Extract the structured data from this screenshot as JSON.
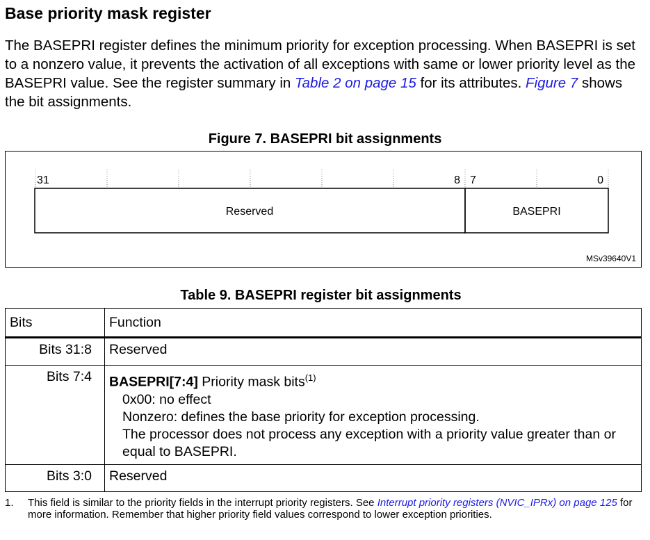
{
  "section_title": "Base priority mask register",
  "intro": {
    "text_before_link1": "The BASEPRI register defines the minimum priority for exception processing. When BASEPRI is set to a nonzero value, it prevents the activation of all exceptions with same or lower priority level as the BASEPRI value. See the register summary in ",
    "link1": "Table 2 on page 15",
    "text_between": " for its attributes. ",
    "link2": "Figure 7",
    "text_after": " shows the bit assignments."
  },
  "figure": {
    "caption": "Figure 7. BASEPRI bit assignments",
    "bit_labels": {
      "b31": "31",
      "b8": "8",
      "b7": "7",
      "b0": "0"
    },
    "fields": {
      "reserved": "Reserved",
      "basepri": "BASEPRI"
    },
    "id": "MSv39640V1"
  },
  "table": {
    "caption": "Table 9. BASEPRI register bit assignments",
    "headers": {
      "bits": "Bits",
      "function": "Function"
    },
    "rows": [
      {
        "bits": "Bits 31:8",
        "function": "Reserved"
      },
      {
        "bits": "Bits 7:4",
        "function_bold": "BASEPRI[7:4]",
        "function_rest": " Priority mask bits",
        "footnote_ref": "(1)",
        "lines": [
          "0x00: no effect",
          "Nonzero: defines the base priority for exception processing.",
          "The processor does not process any exception with a priority value greater than or equal to BASEPRI."
        ]
      },
      {
        "bits": "Bits 3:0",
        "function": "Reserved"
      }
    ]
  },
  "footnote": {
    "number": "1.",
    "text_before": "This field is similar to the priority fields in the interrupt priority registers. See ",
    "link": "Interrupt priority registers (NVIC_IPRx) on page 125",
    "text_after": " for more information. Remember that higher priority field values correspond to lower exception priorities."
  }
}
